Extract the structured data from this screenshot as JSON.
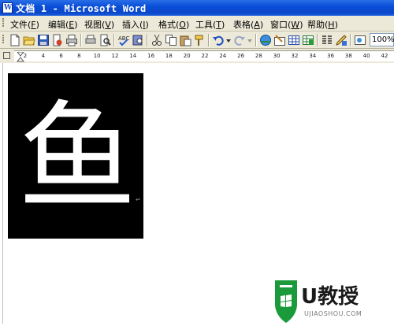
{
  "window": {
    "title": "文档 1 - Microsoft Word",
    "title_icon": "word-document-icon"
  },
  "menu": {
    "items": [
      {
        "label": "文件",
        "key": "F"
      },
      {
        "label": "编辑",
        "key": "E"
      },
      {
        "label": "视图",
        "key": "V"
      },
      {
        "label": "插入",
        "key": "I"
      },
      {
        "label": "格式",
        "key": "O"
      },
      {
        "label": "工具",
        "key": "T"
      },
      {
        "label": "表格",
        "key": "A"
      },
      {
        "label": "窗口",
        "key": "W"
      },
      {
        "label": "帮助",
        "key": "H"
      }
    ]
  },
  "toolbar": {
    "zoom": "100%",
    "icons": [
      "new-document-icon",
      "open-folder-icon",
      "save-icon",
      "permission-icon",
      "print-icon",
      "print-preview-icon",
      "spelling-icon",
      "research-icon",
      "cut-icon",
      "copy-icon",
      "paste-icon",
      "format-painter-icon",
      "undo-icon",
      "redo-icon",
      "hyperlink-icon",
      "tables-borders-icon",
      "insert-table-icon",
      "insert-excel-icon",
      "columns-icon",
      "drawing-icon",
      "document-map-icon"
    ]
  },
  "ruler": {
    "labels": [
      "2",
      "4",
      "6",
      "8",
      "10",
      "12",
      "14",
      "16",
      "18",
      "20",
      "22",
      "24",
      "26",
      "28",
      "30",
      "32",
      "34",
      "36",
      "38",
      "40",
      "42"
    ]
  },
  "document": {
    "image_character": "鱼",
    "paragraph_mark": "↵"
  },
  "watermark": {
    "brand": "U教授",
    "site": "UJIAOSHOU.COM",
    "brand_color": "#1a9a3a"
  }
}
